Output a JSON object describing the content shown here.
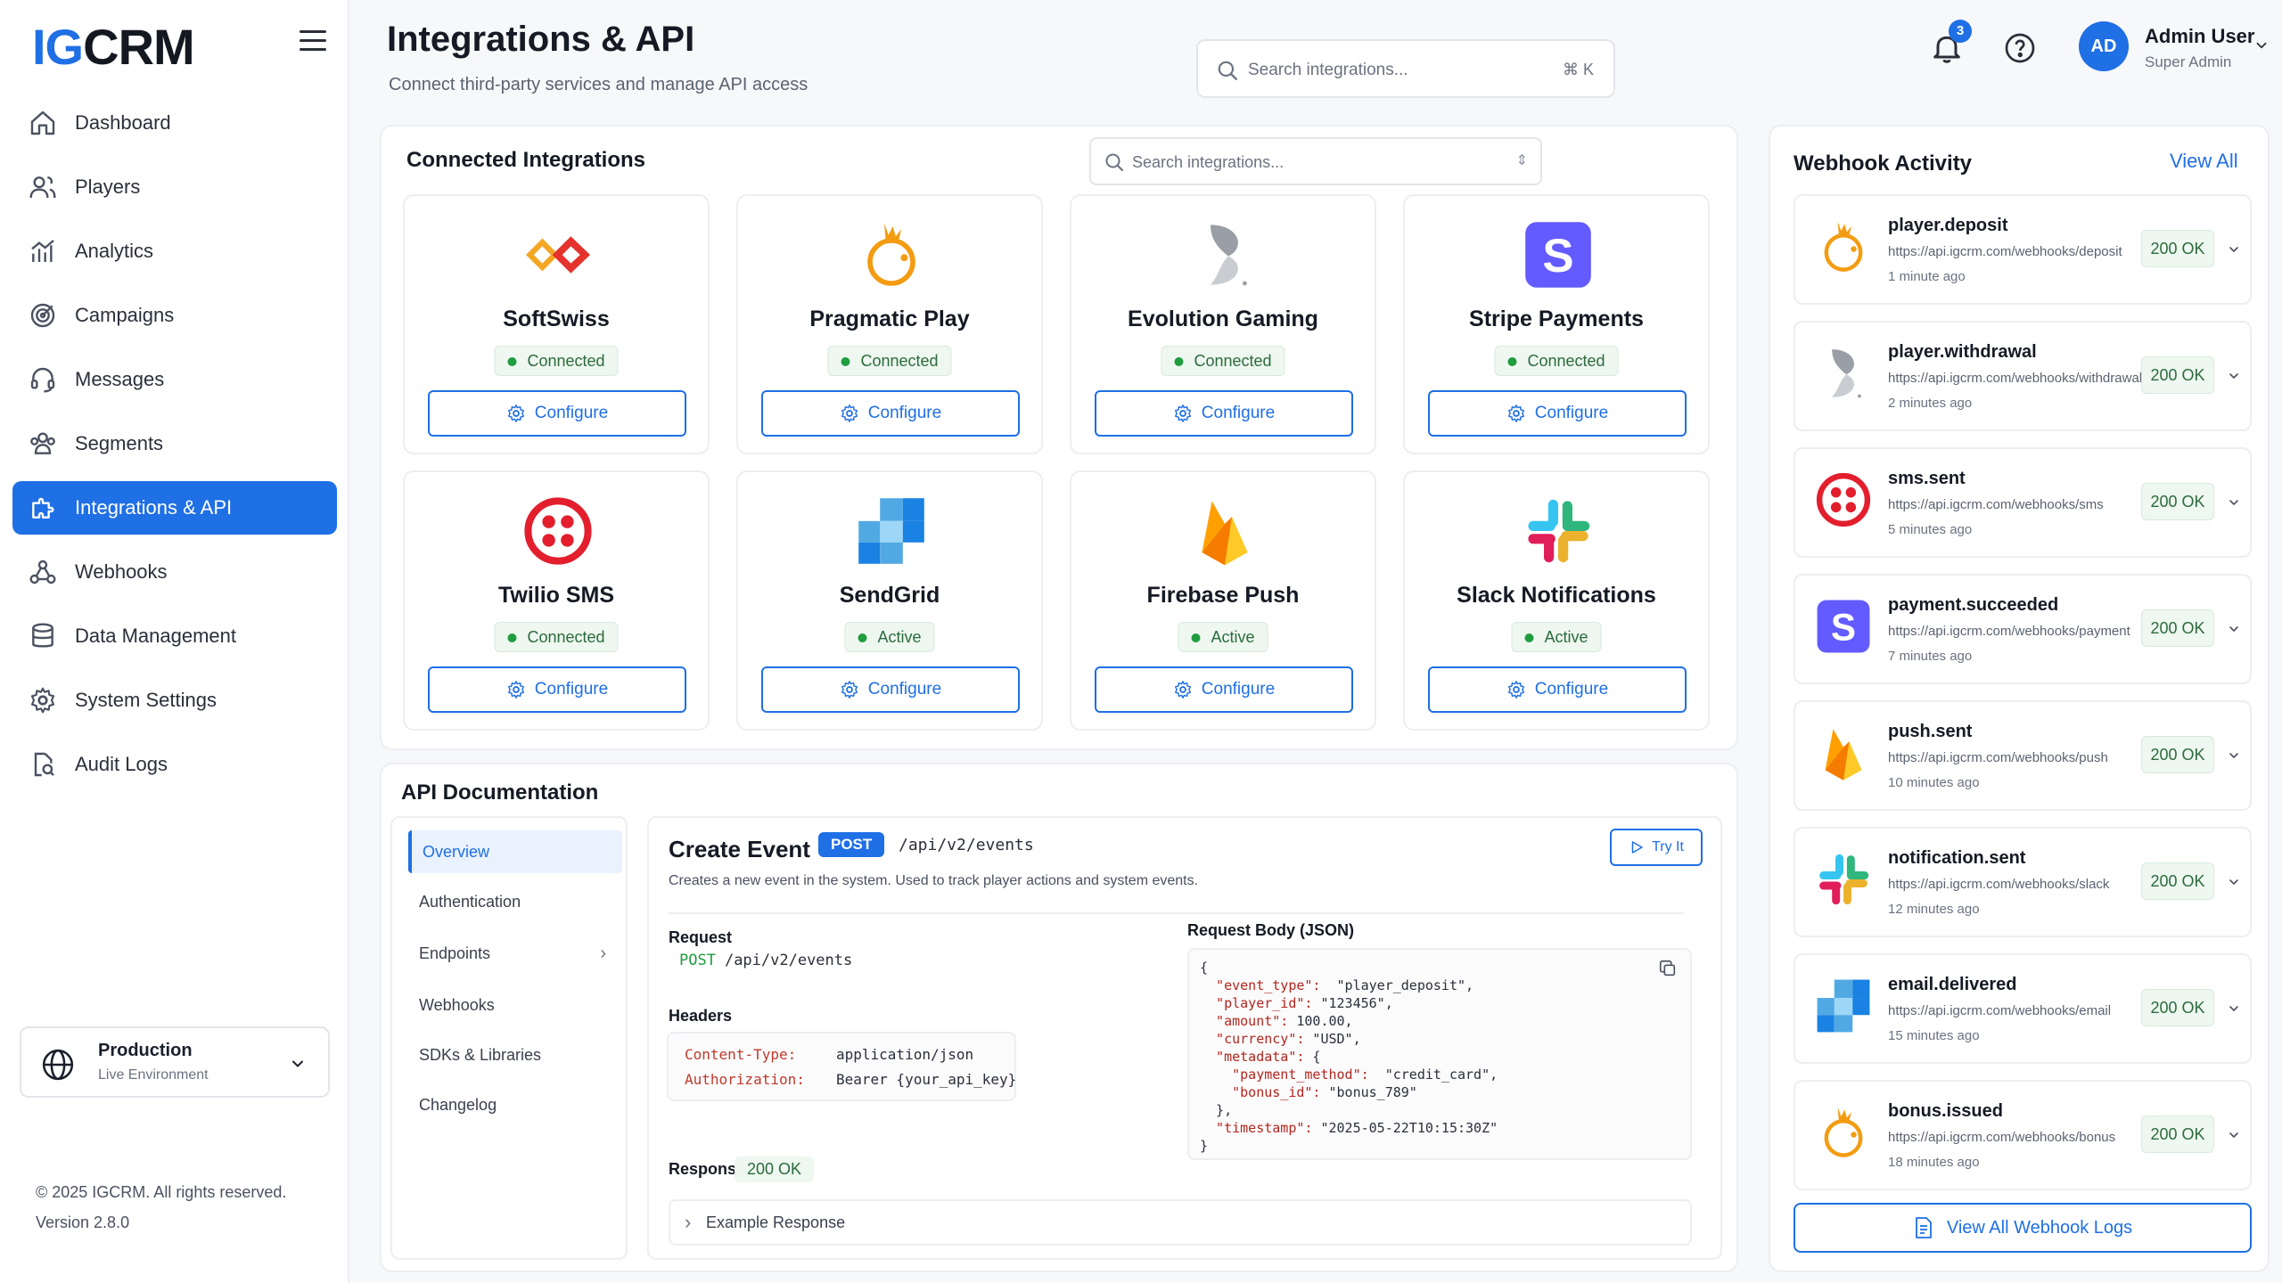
{
  "brand": {
    "logo_left": "IG",
    "logo_right": "CRM"
  },
  "sidebar": {
    "items": [
      {
        "label": "Dashboard",
        "icon": "home-icon"
      },
      {
        "label": "Players",
        "icon": "users-icon"
      },
      {
        "label": "Analytics",
        "icon": "chart-icon"
      },
      {
        "label": "Campaigns",
        "icon": "target-icon"
      },
      {
        "label": "Messages",
        "icon": "headset-icon"
      },
      {
        "label": "Segments",
        "icon": "group-icon"
      },
      {
        "label": "Integrations & API",
        "icon": "puzzle-icon",
        "active": true
      },
      {
        "label": "Webhooks",
        "icon": "webhook-icon"
      },
      {
        "label": "Data Management",
        "icon": "database-icon"
      },
      {
        "label": "System Settings",
        "icon": "gear-icon"
      },
      {
        "label": "Audit Logs",
        "icon": "file-search-icon"
      }
    ],
    "environment": {
      "title": "Production",
      "subtitle": "Live Environment"
    },
    "copyright": "© 2025 IGCRM. All rights reserved.",
    "version": "Version 2.8.0"
  },
  "header": {
    "title": "Integrations & API",
    "subtitle": "Connect third-party services and manage API access",
    "search_placeholder": "Search integrations...",
    "search_shortcut": "⌘ K",
    "notifications_count": "3",
    "user": {
      "initials": "AD",
      "name": "Admin User",
      "role": "Super Admin"
    }
  },
  "integrations": {
    "title": "Connected Integrations",
    "search_placeholder": "Search integrations...",
    "configure_label": "Configure",
    "cards": [
      {
        "name": "SoftSwiss",
        "status": "Connected",
        "logo": "softswiss-logo"
      },
      {
        "name": "Pragmatic Play",
        "status": "Connected",
        "logo": "pragmatic-logo"
      },
      {
        "name": "Evolution Gaming",
        "status": "Connected",
        "logo": "evolution-logo"
      },
      {
        "name": "Stripe Payments",
        "status": "Connected",
        "logo": "stripe-logo"
      },
      {
        "name": "Twilio SMS",
        "status": "Connected",
        "logo": "twilio-logo"
      },
      {
        "name": "SendGrid",
        "status": "Active",
        "logo": "sendgrid-logo"
      },
      {
        "name": "Firebase Push",
        "status": "Active",
        "logo": "firebase-logo"
      },
      {
        "name": "Slack Notifications",
        "status": "Active",
        "logo": "slack-logo"
      }
    ]
  },
  "api_docs": {
    "title": "API Documentation",
    "nav": [
      "Overview",
      "Authentication",
      "Endpoints",
      "Webhooks",
      "SDKs & Libraries",
      "Changelog"
    ],
    "endpoint": {
      "title": "Create Event",
      "method": "POST",
      "path": "/api/v2/events",
      "description": "Creates a new event in the system. Used to track player actions and system events.",
      "try_label": "Try It",
      "request_label": "Request",
      "request_line": "/api/v2/events",
      "headers_label": "Headers",
      "headers": [
        {
          "key": "Content-Type:",
          "value": "application/json"
        },
        {
          "key": "Authorization:",
          "value": "Bearer {your_api_key}"
        }
      ],
      "body_label": "Request Body (JSON)",
      "body_lines": [
        {
          "k": "",
          "v": "{"
        },
        {
          "k": "  \"event_type\":",
          "v": "  \"player_deposit\","
        },
        {
          "k": "  \"player_id\":",
          "v": " \"123456\","
        },
        {
          "k": "  \"amount\":",
          "v": " 100.00,"
        },
        {
          "k": "  \"currency\":",
          "v": " \"USD\","
        },
        {
          "k": "  \"metadata\":",
          "v": " {"
        },
        {
          "k": "    \"payment_method\":",
          "v": "  \"credit_card\","
        },
        {
          "k": "    \"bonus_id\":",
          "v": " \"bonus_789\""
        },
        {
          "k": "",
          "v": "  },"
        },
        {
          "k": "  \"timestamp\":",
          "v": " \"2025-05-22T10:15:30Z\""
        },
        {
          "k": "",
          "v": "}"
        }
      ],
      "response_label": "Response",
      "response_status": "200 OK",
      "example_label": "Example Response"
    }
  },
  "webhooks": {
    "title": "Webhook Activity",
    "view_all": "View All",
    "logs_button": "View All Webhook Logs",
    "items": [
      {
        "event": "player.deposit",
        "url": "https://api.igcrm.com/webhooks/deposit",
        "ago": "1 minute ago",
        "status": "200 OK",
        "logo": "pragmatic-logo"
      },
      {
        "event": "player.withdrawal",
        "url": "https://api.igcrm.com/webhooks/withdrawal",
        "ago": "2 minutes ago",
        "status": "200 OK",
        "logo": "evolution-logo"
      },
      {
        "event": "sms.sent",
        "url": "https://api.igcrm.com/webhooks/sms",
        "ago": "5 minutes ago",
        "status": "200 OK",
        "logo": "twilio-logo"
      },
      {
        "event": "payment.succeeded",
        "url": "https://api.igcrm.com/webhooks/payment",
        "ago": "7 minutes ago",
        "status": "200 OK",
        "logo": "stripe-logo"
      },
      {
        "event": "push.sent",
        "url": "https://api.igcrm.com/webhooks/push",
        "ago": "10 minutes ago",
        "status": "200 OK",
        "logo": "firebase-logo"
      },
      {
        "event": "notification.sent",
        "url": "https://api.igcrm.com/webhooks/slack",
        "ago": "12 minutes ago",
        "status": "200 OK",
        "logo": "slack-logo"
      },
      {
        "event": "email.delivered",
        "url": "https://api.igcrm.com/webhooks/email",
        "ago": "15 minutes ago",
        "status": "200 OK",
        "logo": "sendgrid-logo"
      },
      {
        "event": "bonus.issued",
        "url": "https://api.igcrm.com/webhooks/bonus",
        "ago": "18 minutes ago",
        "status": "200 OK",
        "logo": "pragmatic-logo"
      }
    ]
  },
  "colors": {
    "accent": "#1f6fe5",
    "success": "#1f9d3f",
    "success_bg": "#eef7f0"
  }
}
